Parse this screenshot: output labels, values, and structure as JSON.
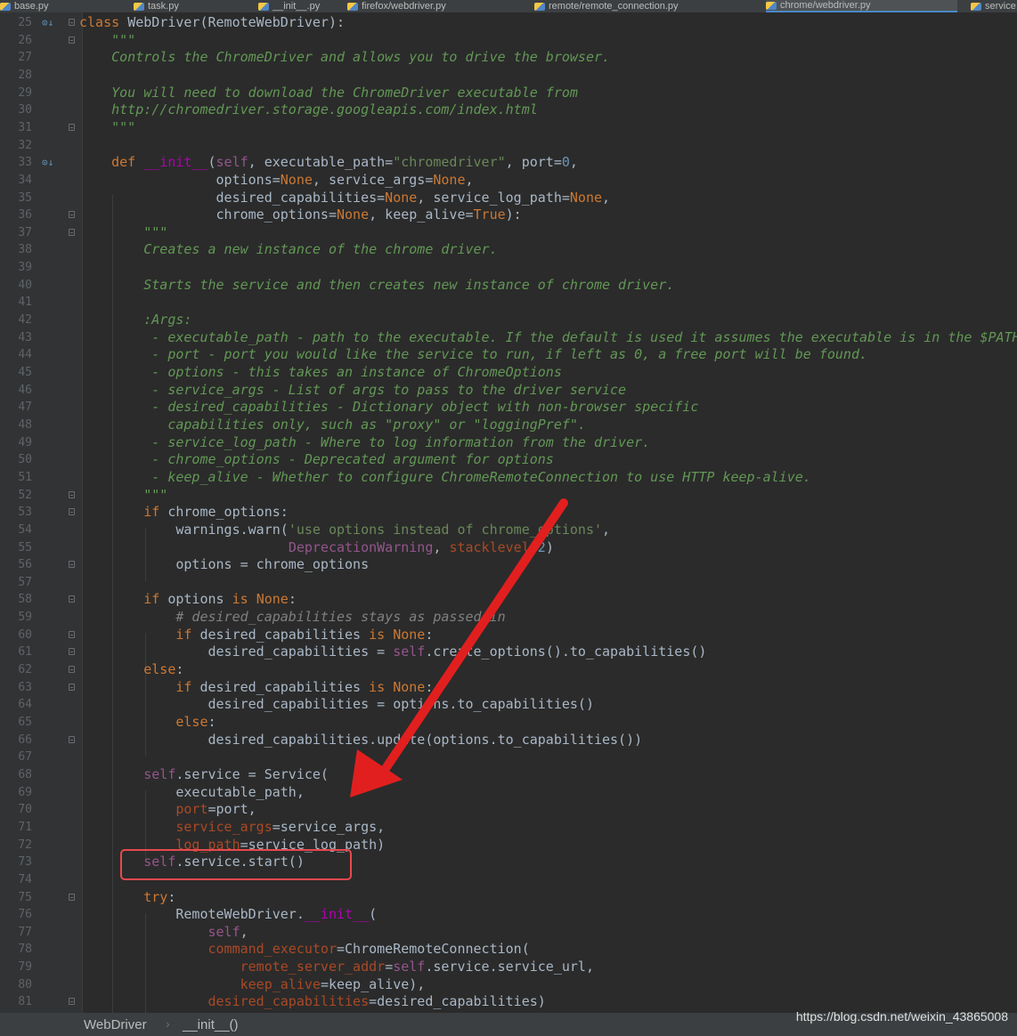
{
  "tabs": [
    {
      "label": "base.py",
      "active": false
    },
    {
      "label": "task.py",
      "active": false
    },
    {
      "label": "__init__.py",
      "active": false
    },
    {
      "label": "firefox/webdriver.py",
      "active": false
    },
    {
      "label": "remote/remote_connection.py",
      "active": false
    },
    {
      "label": "chrome/webdriver.py",
      "active": true
    },
    {
      "label": "service.py",
      "active": false
    }
  ],
  "code_lines": [
    {
      "n": "25",
      "icon": "override",
      "fold": true,
      "segs": [
        [
          "class ",
          "kw"
        ],
        [
          "WebDriver(RemoteWebDriver):",
          "plain"
        ]
      ]
    },
    {
      "n": "26",
      "fold": true,
      "segs": [
        [
          "    \"\"\"",
          "doc"
        ]
      ]
    },
    {
      "n": "27",
      "segs": [
        [
          "    Controls the ChromeDriver and allows you to drive the browser.",
          "doc"
        ]
      ]
    },
    {
      "n": "28",
      "segs": []
    },
    {
      "n": "29",
      "segs": [
        [
          "    You will need to download the ChromeDriver executable from",
          "doc"
        ]
      ]
    },
    {
      "n": "30",
      "segs": [
        [
          "    http://chromedriver.storage.googleapis.com/index.html",
          "doc"
        ]
      ]
    },
    {
      "n": "31",
      "fold": true,
      "segs": [
        [
          "    \"\"\"",
          "doc"
        ]
      ]
    },
    {
      "n": "32",
      "segs": []
    },
    {
      "n": "33",
      "icon": "override",
      "segs": [
        [
          "    ",
          "plain"
        ],
        [
          "def ",
          "kw"
        ],
        [
          "__init__",
          "magic"
        ],
        [
          "(",
          "plain"
        ],
        [
          "self",
          "self"
        ],
        [
          ", executable_path=",
          "plain"
        ],
        [
          "\"chromedriver\"",
          "str"
        ],
        [
          ", port=",
          "plain"
        ],
        [
          "0",
          "num"
        ],
        [
          ",",
          "plain"
        ]
      ]
    },
    {
      "n": "34",
      "segs": [
        [
          "                 options=",
          "plain"
        ],
        [
          "None",
          "const"
        ],
        [
          ", service_args=",
          "plain"
        ],
        [
          "None",
          "const"
        ],
        [
          ",",
          "plain"
        ]
      ]
    },
    {
      "n": "35",
      "segs": [
        [
          "                 desired_capabilities=",
          "plain"
        ],
        [
          "None",
          "const"
        ],
        [
          ", service_log_path=",
          "plain"
        ],
        [
          "None",
          "const"
        ],
        [
          ",",
          "plain"
        ]
      ]
    },
    {
      "n": "36",
      "fold": true,
      "segs": [
        [
          "                 chrome_options=",
          "plain"
        ],
        [
          "None",
          "const"
        ],
        [
          ", keep_alive=",
          "plain"
        ],
        [
          "True",
          "const"
        ],
        [
          "):",
          "plain"
        ]
      ]
    },
    {
      "n": "37",
      "fold": true,
      "segs": [
        [
          "        \"\"\"",
          "doc"
        ]
      ]
    },
    {
      "n": "38",
      "segs": [
        [
          "        Creates a new instance of the chrome driver.",
          "doc"
        ]
      ]
    },
    {
      "n": "39",
      "segs": []
    },
    {
      "n": "40",
      "segs": [
        [
          "        Starts the service and then creates new instance of chrome driver.",
          "doc"
        ]
      ]
    },
    {
      "n": "41",
      "segs": []
    },
    {
      "n": "42",
      "segs": [
        [
          "        :Args:",
          "doc"
        ]
      ]
    },
    {
      "n": "43",
      "segs": [
        [
          "         - executable_path - path to the executable. If the default is used it assumes the executable is in the $PATH",
          "doc"
        ]
      ]
    },
    {
      "n": "44",
      "segs": [
        [
          "         - port - port you would like the service to run, if left as 0, a free port will be found.",
          "doc"
        ]
      ]
    },
    {
      "n": "45",
      "segs": [
        [
          "         - options - this takes an instance of ChromeOptions",
          "doc"
        ]
      ]
    },
    {
      "n": "46",
      "segs": [
        [
          "         - service_args - List of args to pass to the driver service",
          "doc"
        ]
      ]
    },
    {
      "n": "47",
      "segs": [
        [
          "         - desired_capabilities - Dictionary object with non-browser specific",
          "doc"
        ]
      ]
    },
    {
      "n": "48",
      "segs": [
        [
          "           capabilities only, such as \"proxy\" or \"loggingPref\".",
          "doc"
        ]
      ]
    },
    {
      "n": "49",
      "segs": [
        [
          "         - service_log_path - Where to log information from the driver.",
          "doc"
        ]
      ]
    },
    {
      "n": "50",
      "segs": [
        [
          "         - chrome_options - Deprecated argument for options",
          "doc"
        ]
      ]
    },
    {
      "n": "51",
      "segs": [
        [
          "         - keep_alive - Whether to configure ChromeRemoteConnection to use HTTP keep-alive.",
          "doc"
        ]
      ]
    },
    {
      "n": "52",
      "fold": true,
      "segs": [
        [
          "        \"\"\"",
          "doc"
        ]
      ]
    },
    {
      "n": "53",
      "fold": true,
      "segs": [
        [
          "        ",
          "plain"
        ],
        [
          "if ",
          "kw"
        ],
        [
          "chrome_options:",
          "plain"
        ]
      ]
    },
    {
      "n": "54",
      "segs": [
        [
          "            warnings.warn(",
          "plain"
        ],
        [
          "'use options instead of chrome_options'",
          "str"
        ],
        [
          ",",
          "plain"
        ]
      ]
    },
    {
      "n": "55",
      "segs": [
        [
          "                          ",
          "plain"
        ],
        [
          "DeprecationWarning",
          "self"
        ],
        [
          ", ",
          "plain"
        ],
        [
          "stacklevel",
          "param"
        ],
        [
          "=",
          "plain"
        ],
        [
          "2",
          "num"
        ],
        [
          ")",
          "plain"
        ]
      ]
    },
    {
      "n": "56",
      "fold": true,
      "segs": [
        [
          "            options = chrome_options",
          "plain"
        ]
      ]
    },
    {
      "n": "57",
      "segs": []
    },
    {
      "n": "58",
      "fold": true,
      "segs": [
        [
          "        ",
          "plain"
        ],
        [
          "if ",
          "kw"
        ],
        [
          "options ",
          "plain"
        ],
        [
          "is ",
          "kw"
        ],
        [
          "None",
          "const"
        ],
        [
          ":",
          "plain"
        ]
      ]
    },
    {
      "n": "59",
      "segs": [
        [
          "            ",
          "plain"
        ],
        [
          "# desired_capabilities stays as passed in",
          "cmt"
        ]
      ]
    },
    {
      "n": "60",
      "fold": true,
      "segs": [
        [
          "            ",
          "plain"
        ],
        [
          "if ",
          "kw"
        ],
        [
          "desired_capabilities ",
          "plain"
        ],
        [
          "is ",
          "kw"
        ],
        [
          "None",
          "const"
        ],
        [
          ":",
          "plain"
        ]
      ]
    },
    {
      "n": "61",
      "fold": true,
      "segs": [
        [
          "                desired_capabilities = ",
          "plain"
        ],
        [
          "self",
          "self"
        ],
        [
          ".create_options().to_capabilities()",
          "plain"
        ]
      ]
    },
    {
      "n": "62",
      "fold": true,
      "segs": [
        [
          "        ",
          "plain"
        ],
        [
          "else",
          "kw"
        ],
        [
          ":",
          "plain"
        ]
      ]
    },
    {
      "n": "63",
      "fold": true,
      "segs": [
        [
          "            ",
          "plain"
        ],
        [
          "if ",
          "kw"
        ],
        [
          "desired_capabilities ",
          "plain"
        ],
        [
          "is ",
          "kw"
        ],
        [
          "None",
          "const"
        ],
        [
          ":",
          "plain"
        ]
      ]
    },
    {
      "n": "64",
      "segs": [
        [
          "                desired_capabilities = options.to_capabilities()",
          "plain"
        ]
      ]
    },
    {
      "n": "65",
      "segs": [
        [
          "            ",
          "plain"
        ],
        [
          "else",
          "kw"
        ],
        [
          ":",
          "plain"
        ]
      ]
    },
    {
      "n": "66",
      "fold": true,
      "segs": [
        [
          "                desired_capabilities.update(options.to_capabilities())",
          "plain"
        ]
      ]
    },
    {
      "n": "67",
      "segs": []
    },
    {
      "n": "68",
      "segs": [
        [
          "        ",
          "plain"
        ],
        [
          "self",
          "self"
        ],
        [
          ".service = Service(",
          "plain"
        ]
      ]
    },
    {
      "n": "69",
      "segs": [
        [
          "            executable_path,",
          "plain"
        ]
      ]
    },
    {
      "n": "70",
      "segs": [
        [
          "            ",
          "plain"
        ],
        [
          "port",
          "param"
        ],
        [
          "=port,",
          "plain"
        ]
      ]
    },
    {
      "n": "71",
      "segs": [
        [
          "            ",
          "plain"
        ],
        [
          "service_args",
          "param"
        ],
        [
          "=service_args,",
          "plain"
        ]
      ]
    },
    {
      "n": "72",
      "segs": [
        [
          "            ",
          "plain"
        ],
        [
          "log_path",
          "param"
        ],
        [
          "=service_log_path)",
          "plain"
        ]
      ]
    },
    {
      "n": "73",
      "segs": [
        [
          "        ",
          "plain"
        ],
        [
          "self",
          "self"
        ],
        [
          ".service.start()",
          "plain"
        ]
      ]
    },
    {
      "n": "74",
      "segs": []
    },
    {
      "n": "75",
      "fold": true,
      "segs": [
        [
          "        ",
          "plain"
        ],
        [
          "try",
          "kw"
        ],
        [
          ":",
          "plain"
        ]
      ]
    },
    {
      "n": "76",
      "segs": [
        [
          "            RemoteWebDriver.",
          "plain"
        ],
        [
          "__init__",
          "magic"
        ],
        [
          "(",
          "plain"
        ]
      ]
    },
    {
      "n": "77",
      "segs": [
        [
          "                ",
          "plain"
        ],
        [
          "self",
          "self"
        ],
        [
          ",",
          "plain"
        ]
      ]
    },
    {
      "n": "78",
      "segs": [
        [
          "                ",
          "plain"
        ],
        [
          "command_executor",
          "param"
        ],
        [
          "=ChromeRemoteConnection(",
          "plain"
        ]
      ]
    },
    {
      "n": "79",
      "segs": [
        [
          "                    ",
          "plain"
        ],
        [
          "remote_server_addr",
          "param"
        ],
        [
          "=",
          "plain"
        ],
        [
          "self",
          "self"
        ],
        [
          ".service.service_url,",
          "plain"
        ]
      ]
    },
    {
      "n": "80",
      "segs": [
        [
          "                    ",
          "plain"
        ],
        [
          "keep_alive",
          "param"
        ],
        [
          "=keep_alive),",
          "plain"
        ]
      ]
    },
    {
      "n": "81",
      "fold": true,
      "segs": [
        [
          "                ",
          "plain"
        ],
        [
          "desired_capabilities",
          "param"
        ],
        [
          "=desired_capabilities)",
          "plain"
        ]
      ]
    }
  ],
  "breadcrumb": {
    "class_name": "WebDriver",
    "separator": "›",
    "method_name": "__init__()"
  },
  "watermark": "https://blog.csdn.net/weixin_43865008",
  "annotation": {
    "box_color": "#e8484f",
    "arrow_color": "#e21f1f"
  },
  "colors": {
    "background": "#2b2b2b",
    "gutter": "#313335",
    "keyword": "#cc7832",
    "docstring": "#629755",
    "string": "#6a8759",
    "number": "#6897bb",
    "self": "#94558d",
    "magic": "#b200b2",
    "param": "#aa4926"
  }
}
